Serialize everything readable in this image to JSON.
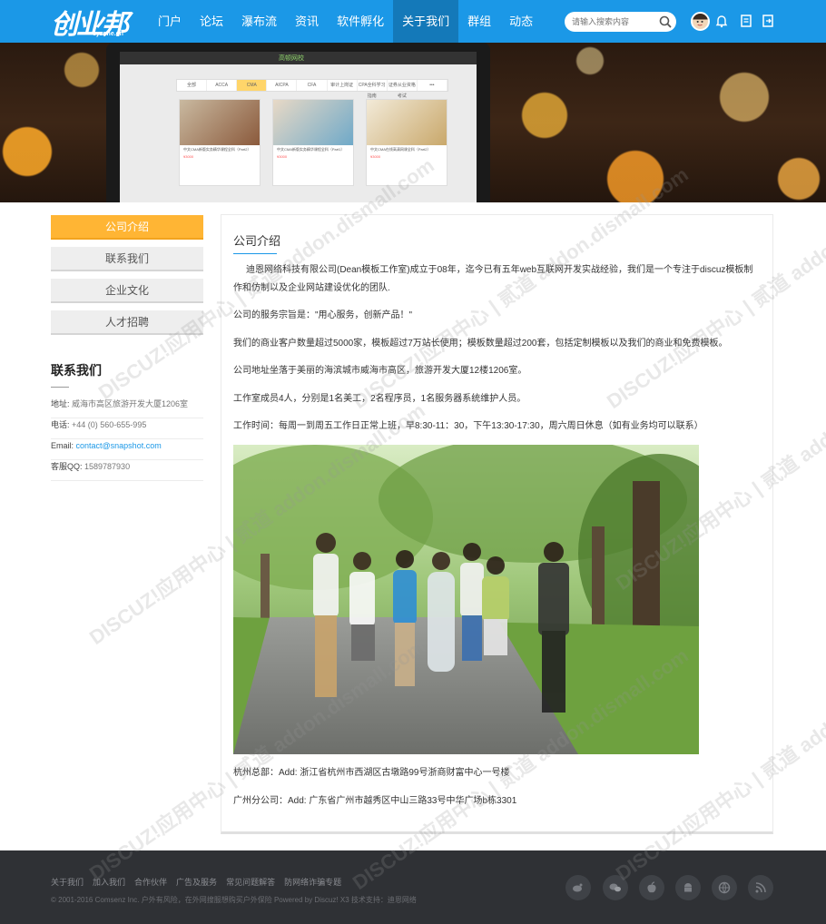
{
  "header": {
    "logo_cn": "创业邦",
    "logo_en": "cyzone.cn",
    "nav": [
      "门户",
      "论坛",
      "瀑布流",
      "资讯",
      "软件孵化",
      "关于我们",
      "群组",
      "动态"
    ],
    "active_nav": "关于我们",
    "search_placeholder": "请输入搜索内容"
  },
  "banner": {
    "screen_brand": "高顿网校",
    "screen_tabs": [
      "全部",
      "ACCA",
      "CMA",
      "AICPA",
      "CFA",
      "审计上岗证",
      "CPA全科学习指南",
      "证券从业资格考试",
      "•••"
    ],
    "active_tab": "CMA",
    "cards": [
      {
        "title": "中文CMA新版实务精华课程全科（Part2）",
        "price": "¥3000"
      },
      {
        "title": "中文CMA新版实务精华课程全科（Part1）",
        "price": "¥3000"
      },
      {
        "title": "中文CMA在线高清网课全科（Part2）",
        "price": "¥3000"
      }
    ]
  },
  "sidebar": {
    "menu": [
      "公司介绍",
      "联系我们",
      "企业文化",
      "人才招聘"
    ],
    "active": "公司介绍",
    "contact_title": "联系我们",
    "contact": [
      {
        "label": "地址: ",
        "value": "威海市高区旅游开发大厦1206室"
      },
      {
        "label": "电话: ",
        "value": "+44 (0) 560-655-995"
      },
      {
        "label": "Email: ",
        "value": "contact@snapshot.com"
      },
      {
        "label": "客服QQ: ",
        "value": "1589787930"
      }
    ]
  },
  "main": {
    "title": "公司介绍",
    "paragraphs": [
      "迪恩网络科技有限公司(Dean模板工作室)成立于08年，迄今已有五年web互联网开发实战经验，我们是一个专注于discuz模板制作和仿制以及企业网站建设优化的团队.",
      "公司的服务宗旨是：\"用心服务，创新产品！\"",
      "我们的商业客户数量超过5000家，模板超过7万站长使用；模板数量超过200套，包括定制模板以及我们的商业和免费模板。",
      "公司地址坐落于美丽的海滨城市威海市高区，旅游开发大厦12楼1206室。",
      "工作室成员4人，分别是1名美工，2名程序员，1名服务器系统维护人员。",
      "工作时间：每周一到周五工作日正常上班，早8:30-11：30，下午13:30-17:30，周六周日休息（如有业务均可以联系）"
    ],
    "addresses": [
      "杭州总部：Add: 浙江省杭州市西湖区古墩路99号浙商财富中心一号楼",
      "广州分公司：Add: 广东省广州市越秀区中山三路33号中华广场b栋3301"
    ]
  },
  "footer": {
    "links": [
      "关于我们",
      "加入我们",
      "合作伙伴",
      "广告及服务",
      "常见问题解答",
      "防网络诈骗专题"
    ],
    "copyright": "© 2001-2016 Comsenz Inc. 户外有风险，在外网搜服想购买户外保险  Powered by  Discuz! X3  技术支持：迪恩网络",
    "social": [
      "weibo-icon",
      "wechat-icon",
      "apple-icon",
      "android-icon",
      "globe-icon",
      "rss-icon"
    ]
  },
  "watermark": "DISCUZ!应用中心 | 贰道 addon.dismall.com",
  "colors": {
    "primary": "#1b98e7",
    "accent": "#ffb534",
    "footer": "#2f3135"
  }
}
